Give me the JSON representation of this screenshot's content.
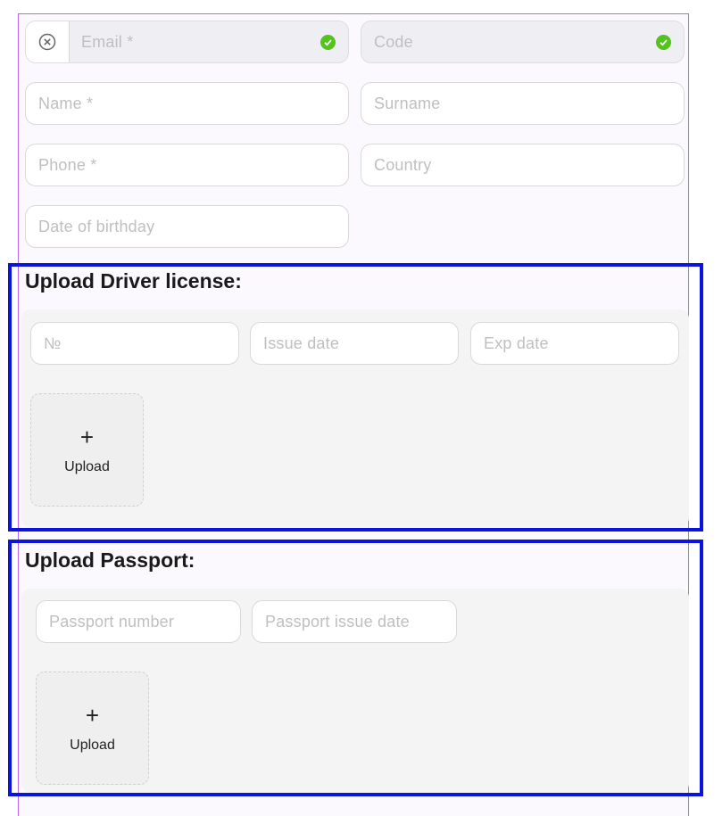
{
  "contact": {
    "email_placeholder": "Email *",
    "code_placeholder": "Code",
    "name_placeholder": "Name *",
    "surname_placeholder": "Surname",
    "phone_placeholder": "Phone *",
    "country_placeholder": "Country",
    "birthday_placeholder": "Date of birthday"
  },
  "driver_license": {
    "title": "Upload Driver license:",
    "number_placeholder": "№",
    "issue_date_placeholder": "Issue date",
    "exp_date_placeholder": "Exp date",
    "upload_label": "Upload",
    "upload_plus": "+"
  },
  "passport": {
    "title": "Upload Passport:",
    "number_placeholder": "Passport number",
    "issue_date_placeholder": "Passport issue date",
    "upload_label": "Upload",
    "upload_plus": "+"
  },
  "icons": {
    "clear": "close-circle-icon",
    "valid": "check-circle-icon"
  },
  "colors": {
    "accent_border": "#b56bf0",
    "highlight_frame": "#0a13e0",
    "success": "#52c41a"
  }
}
